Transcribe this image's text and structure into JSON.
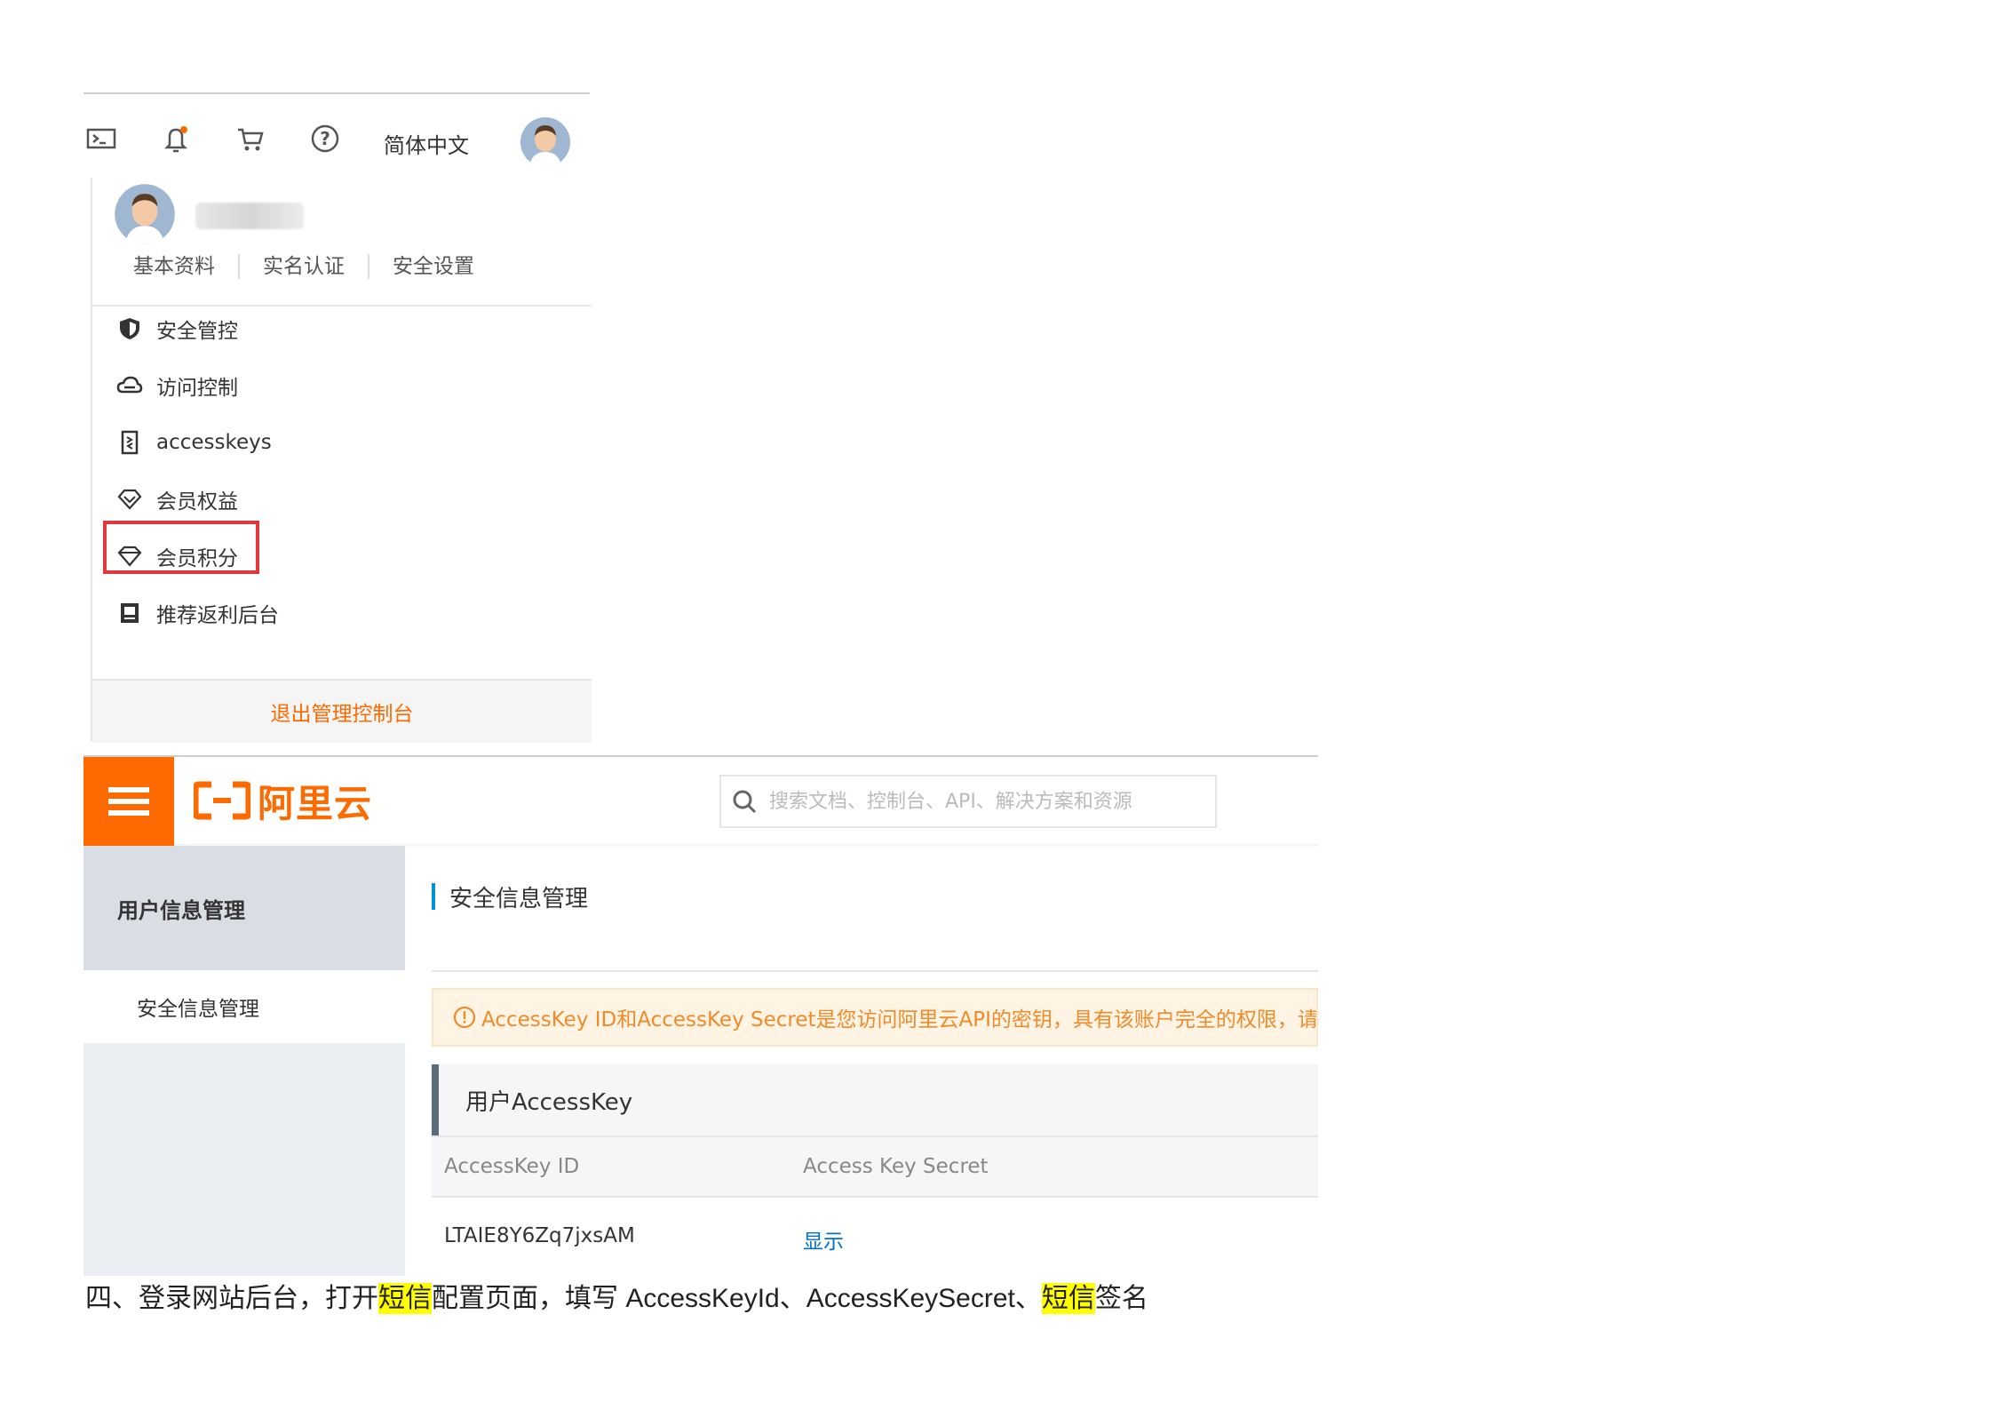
{
  "top_panel": {
    "language": "简体中文",
    "profile_links": [
      "基本资料",
      "实名认证",
      "安全设置"
    ],
    "menu": [
      {
        "label": "安全管控",
        "icon": "shield-icon"
      },
      {
        "label": "访问控制",
        "icon": "cloud-icon"
      },
      {
        "label": "accesskeys",
        "icon": "key-icon",
        "highlighted": true
      },
      {
        "label": "会员权益",
        "icon": "diamond-icon"
      },
      {
        "label": "会员积分",
        "icon": "gem-icon"
      },
      {
        "label": "推荐返利后台",
        "icon": "book-icon"
      }
    ],
    "logout": "退出管理控制台",
    "accent_color": "#ff6a00",
    "highlight_color": "#e4393c"
  },
  "console": {
    "logo_text": "阿里云",
    "search_placeholder": "搜索文档、控制台、API、解决方案和资源",
    "sidebar_header": "用户信息管理",
    "sidebar_item": "安全信息管理",
    "page_title": "安全信息管理",
    "notice": "AccessKey ID和AccessKey Secret是您访问阿里云API的密钥，具有该账户完全的权限，请",
    "panel_title": "用户AccessKey",
    "table": {
      "columns": [
        "AccessKey ID",
        "Access Key Secret"
      ],
      "rows": [
        {
          "id": "LTAIE8Y6Zq7jxsAM",
          "secret_action": "显示"
        }
      ]
    },
    "brand_color": "#ff6a00",
    "link_color": "#0070cc"
  },
  "caption": {
    "part1": "四、登录网站后台，打开",
    "hl1": "短信",
    "part2": "配置页面，填写",
    "latin1": " AccessKeyId",
    "part3": "、",
    "latin2": "AccessKeySecret",
    "part4": "、",
    "hl2": "短信",
    "part5": "签名",
    "highlight_color": "#ffff00"
  }
}
